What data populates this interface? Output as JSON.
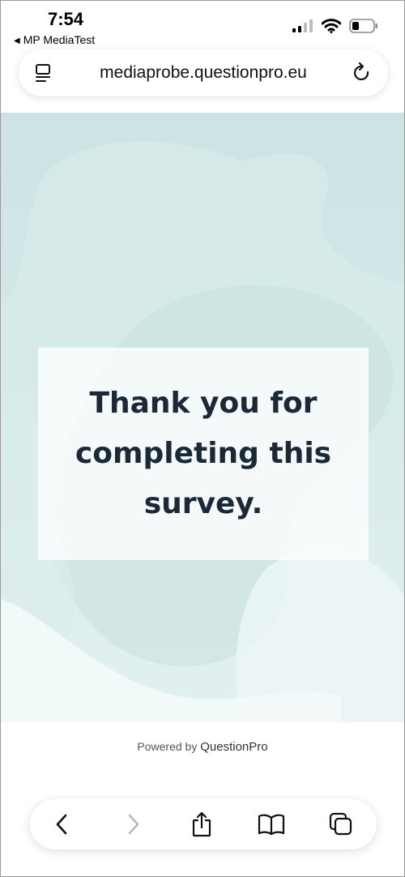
{
  "status_bar": {
    "time": "7:54",
    "back_app": "MP MediaTest",
    "icons": [
      "signal-icon",
      "wifi-icon",
      "battery-icon"
    ]
  },
  "browser": {
    "url": "mediaprobe.questionpro.eu",
    "icons": [
      "reader-icon",
      "reload-icon"
    ]
  },
  "page": {
    "thank_you": "Thank you for completing this survey.",
    "powered_by": "Powered by",
    "brand": "QuestionPro"
  },
  "toolbar": {
    "items": [
      "back-icon",
      "forward-icon",
      "share-icon",
      "bookmarks-icon",
      "tabs-icon"
    ]
  },
  "colors": {
    "background_teal": "#cde3e3",
    "heading": "#1b2838"
  }
}
